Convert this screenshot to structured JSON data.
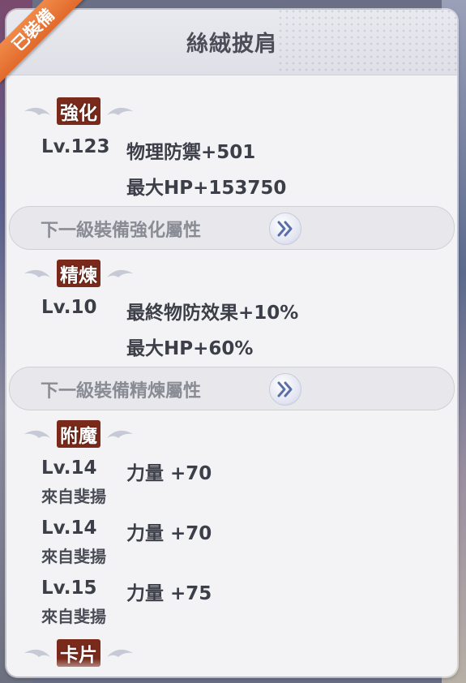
{
  "panel": {
    "title": "絲絨披肩",
    "equipped_badge": "已裝備"
  },
  "sections": {
    "enhance": {
      "title": "強化",
      "level": "Lv.123",
      "stats": [
        "物理防禦+501",
        "最大HP+153750"
      ],
      "next_label": "下一級裝備強化屬性"
    },
    "refine": {
      "title": "精煉",
      "level": "Lv.10",
      "stats": [
        "最終物防效果+10%",
        "最大HP+60%"
      ],
      "next_label": "下一級裝備精煉屬性"
    },
    "enchant": {
      "title": "附魔",
      "entries": [
        {
          "level": "Lv.14",
          "stat": "力量 +70",
          "source": "來自斐揚"
        },
        {
          "level": "Lv.14",
          "stat": "力量 +70",
          "source": "來自斐揚"
        },
        {
          "level": "Lv.15",
          "stat": "力量 +75",
          "source": "來自斐揚"
        }
      ]
    },
    "card": {
      "title": "卡片"
    }
  },
  "icons": {
    "section_wing": "wing-icon",
    "next_arrow": "double-chevron-right-icon",
    "accent": "#7a2a1a",
    "ribbon": "#e8743a"
  }
}
